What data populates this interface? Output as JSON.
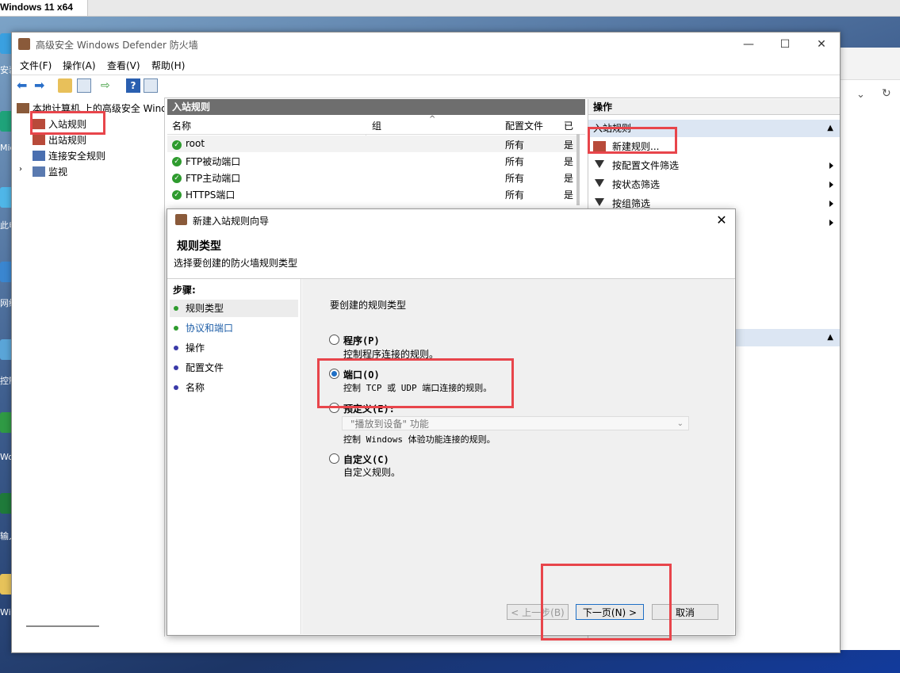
{
  "vm": {
    "tab_title": "Windows 11 x64"
  },
  "desktop": {
    "labels": [
      "安装",
      "Micros Edge",
      "此电脑",
      "网络",
      "控制面板",
      "Word Sd",
      "输入面",
      "Wind"
    ]
  },
  "window": {
    "title": "高级安全 Windows Defender 防火墙",
    "controls": [
      "—",
      "☐",
      "✕"
    ],
    "menu": [
      "文件(F)",
      "操作(A)",
      "查看(V)",
      "帮助(H)"
    ]
  },
  "tree": {
    "root": "本地计算机 上的高级安全 Windo",
    "items": [
      "入站规则",
      "出站规则",
      "连接安全规则",
      "监视"
    ]
  },
  "center": {
    "header": "入站规则",
    "columns": [
      "名称",
      "组",
      "配置文件",
      "已"
    ],
    "rows": [
      {
        "name": "root",
        "profile": "所有",
        "enabled": "是"
      },
      {
        "name": "FTP被动端口",
        "profile": "所有",
        "enabled": "是"
      },
      {
        "name": "FTP主动端口",
        "profile": "所有",
        "enabled": "是"
      },
      {
        "name": "HTTPS端口",
        "profile": "所有",
        "enabled": "是"
      }
    ]
  },
  "actions": {
    "header": "操作",
    "section": "入站规则",
    "items": [
      "新建规则...",
      "按配置文件筛选",
      "按状态筛选",
      "按组筛选"
    ]
  },
  "dialog": {
    "title": "新建入站规则向导",
    "heading": "规则类型",
    "subtitle": "选择要创建的防火墙规则类型",
    "steps_title": "步骤:",
    "steps": [
      "规则类型",
      "协议和端口",
      "操作",
      "配置文件",
      "名称"
    ],
    "question": "要创建的规则类型",
    "options": [
      {
        "label": "程序(P)",
        "desc": "控制程序连接的规则。"
      },
      {
        "label": "端口(O)",
        "desc": "控制 TCP 或 UDP 端口连接的规则。"
      },
      {
        "label": "预定义(E):",
        "desc": "控制 Windows 体验功能连接的规则。"
      },
      {
        "label": "自定义(C)",
        "desc": "自定义规则。"
      }
    ],
    "predefined_value": "\"播放到设备\" 功能",
    "buttons": {
      "back": "< 上一步(B)",
      "next": "下一页(N) >",
      "cancel": "取消"
    }
  },
  "colors": {
    "highlight_red": "#e8454b",
    "accent_blue": "#1f6fc5"
  }
}
